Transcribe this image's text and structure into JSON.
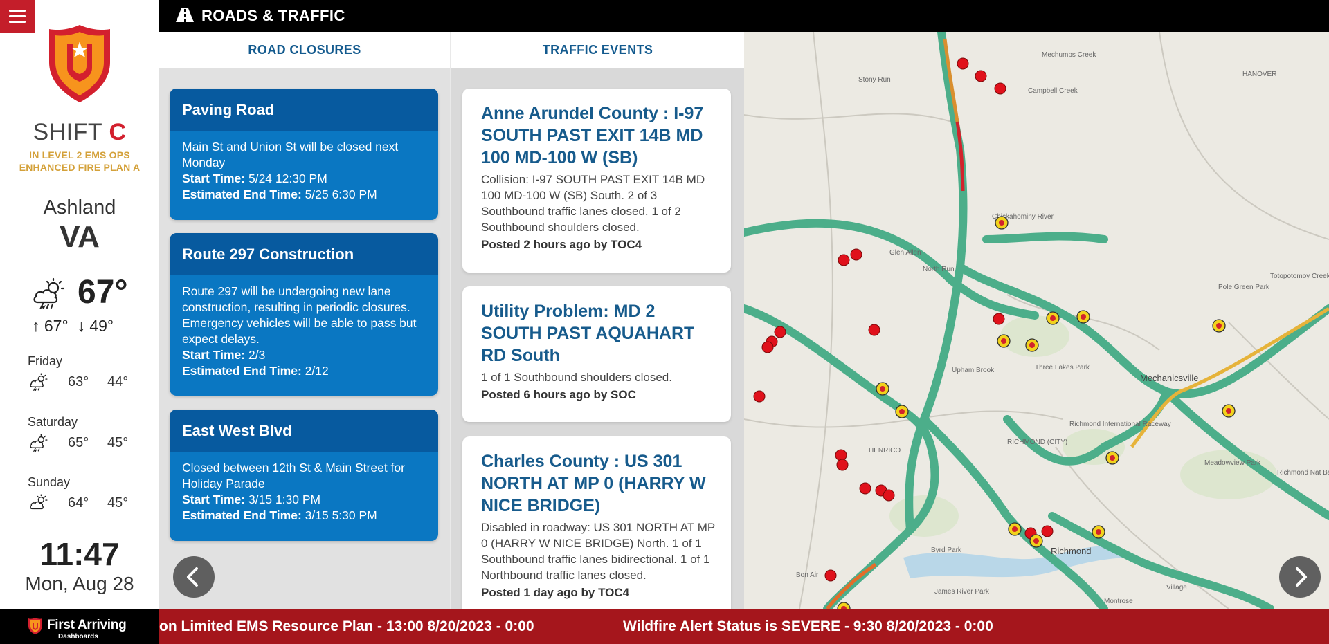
{
  "colors": {
    "accent_red": "#c41e2a",
    "header_black": "#000000",
    "closure_blue": "#0a77c2",
    "closure_title_blue": "#075a9f",
    "event_title_blue": "#175b8c",
    "ops_gold": "#d4a13a",
    "ticker_red": "#a5161c"
  },
  "sidebar": {
    "shift_label": "SHIFT",
    "shift_letter": "C",
    "ops_line1": "IN LEVEL 2 EMS OPS",
    "ops_line2": "ENHANCED FIRE PLAN A",
    "city": "Ashland",
    "state": "VA",
    "current": {
      "icon": "thunderstorm-icon",
      "temp": "67°",
      "high": "67°",
      "low": "49°"
    },
    "forecast": [
      {
        "day": "Friday",
        "icon": "thunderstorm-icon",
        "high": "63°",
        "low": "44°"
      },
      {
        "day": "Saturday",
        "icon": "thunderstorm-icon",
        "high": "65°",
        "low": "45°"
      },
      {
        "day": "Sunday",
        "icon": "partly-cloudy-icon",
        "high": "64°",
        "low": "45°"
      }
    ],
    "time": "11:47",
    "date": "Mon, Aug 28"
  },
  "brand": {
    "name": "First Arriving",
    "sub": "Dashboards"
  },
  "header": {
    "icon": "road-icon",
    "title": "ROADS & TRAFFIC"
  },
  "tabs": {
    "closures": "ROAD CLOSURES",
    "events": "TRAFFIC EVENTS"
  },
  "closures": [
    {
      "title": "Paving Road",
      "description": "Main St and Union St will be closed next Monday",
      "start_label": "Start Time:",
      "start": "5/24 12:30 PM",
      "end_label": "Estimated End Time:",
      "end": "5/25 6:30 PM"
    },
    {
      "title": "Route 297 Construction",
      "description": "Route 297 will be undergoing new lane construction, resulting in periodic closures. Emergency vehicles will be able to pass but expect delays.",
      "start_label": "Start Time:",
      "start": "2/3",
      "end_label": "Estimated End Time:",
      "end": "2/12"
    },
    {
      "title": "East West Blvd",
      "description": "Closed between 12th St & Main Street for Holiday Parade",
      "start_label": "Start Time:",
      "start": "3/15 1:30 PM",
      "end_label": "Estimated End Time:",
      "end": "3/15 5:30 PM"
    }
  ],
  "events": [
    {
      "title": "Anne Arundel County : I-97 SOUTH PAST EXIT 14B MD 100 MD-100 W (SB)",
      "description": "Collision: I-97 SOUTH PAST EXIT 14B MD 100 MD-100 W (SB) South. 2 of 3 Southbound traffic lanes closed. 1 of 2 Southbound shoulders closed.",
      "posted": "Posted 2 hours ago by TOC4"
    },
    {
      "title": "Utility Problem: MD 2 SOUTH PAST AQUAHART RD South",
      "description": "1 of 1 Southbound shoulders closed.",
      "posted": "Posted 6 hours ago by SOC"
    },
    {
      "title": "Charles County : US 301 NORTH AT MP 0 (HARRY W NICE BRIDGE)",
      "description": "Disabled in roadway: US 301 NORTH AT MP 0 (HARRY W NICE BRIDGE) North. 1 of 1 Southbound traffic lanes bidirectional. 1 of 1 Northbound traffic lanes closed.",
      "posted": "Posted 1 day ago by TOC4"
    }
  ],
  "map": {
    "labels": [
      "Mechumps Creek",
      "Stony Run",
      "Campbell Creek",
      "HANOVER",
      "Glen Allen",
      "North Run",
      "Totopotomoy Creek",
      "Pole Green Park",
      "Chickahominy River",
      "Mechanicsville",
      "Three Lakes Park",
      "Upham Brook",
      "HENRICO",
      "RICHMOND (CITY)",
      "Richmond International Raceway",
      "Meadowview Park",
      "Richmond Nat Battlefield",
      "Byrd Park",
      "Bon Air",
      "James River Park",
      "Village",
      "Montrose",
      "Richmond"
    ]
  },
  "nav": {
    "prev_icon": "chevron-left-icon",
    "next_icon": "chevron-right-icon"
  },
  "ticker": {
    "items": [
      "on Limited EMS Resource Plan - 13:00 8/20/2023 - 0:00",
      "Wildfire Alert Status is SEVERE - 9:30 8/20/2023 - 0:00"
    ]
  }
}
